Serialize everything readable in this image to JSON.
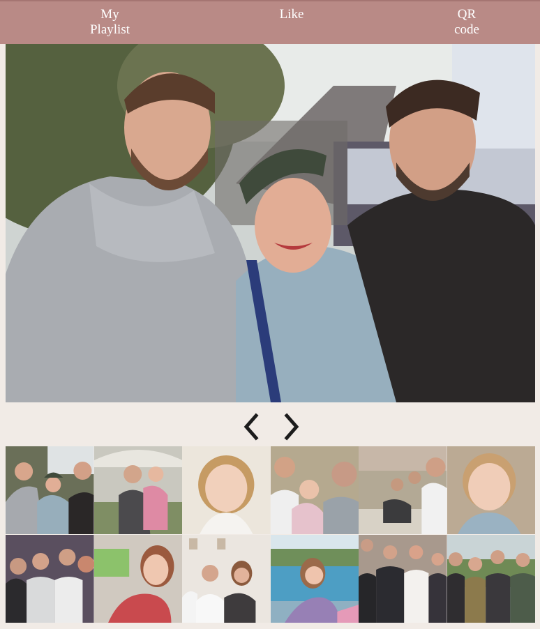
{
  "nav": {
    "playlist_label": "My\nPlaylist",
    "like_label": "Like",
    "qr_label": "QR\ncode"
  },
  "colors": {
    "topbar": "#b98a86",
    "page_background": "#f1ebe6",
    "arrow": "#1c1c1c"
  },
  "icons": {
    "prev": "chevron-left-icon",
    "next": "chevron-right-icon"
  },
  "gallery": {
    "count": 12
  }
}
